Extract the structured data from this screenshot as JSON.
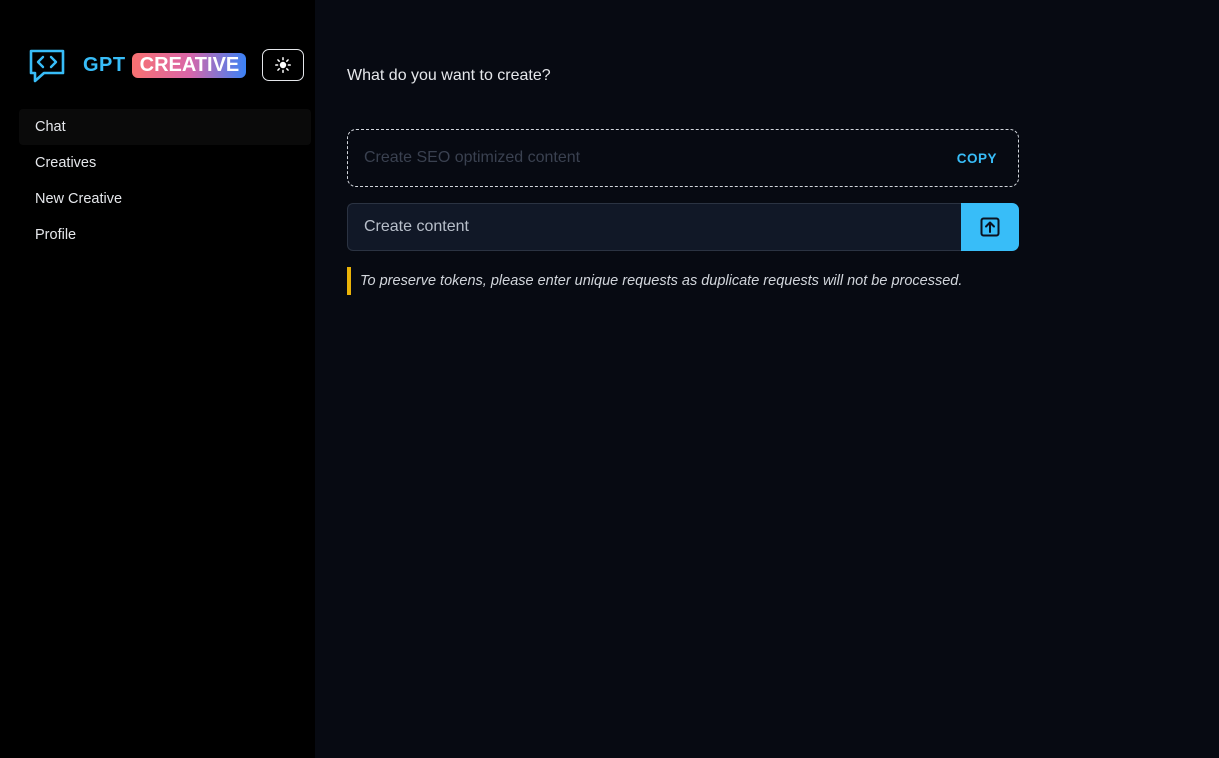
{
  "brand": {
    "gpt": "GPT",
    "creative": "CREATIVE"
  },
  "theme_toggle": {
    "icon": "sun-icon"
  },
  "nav": {
    "items": [
      {
        "label": "Chat",
        "active": true
      },
      {
        "label": "Creatives",
        "active": false
      },
      {
        "label": "New Creative",
        "active": false
      },
      {
        "label": "Profile",
        "active": false
      }
    ]
  },
  "main": {
    "question": "What do you want to create?",
    "output_placeholder": "Create SEO optimized content",
    "copy_label": "COPY",
    "input_placeholder": "Create content",
    "input_value": "",
    "notice": "To preserve tokens, please enter unique requests as duplicate requests will not be processed."
  },
  "colors": {
    "accent": "#38bdf8",
    "notice_bar": "#eab308",
    "sidebar_bg": "#000000",
    "main_bg": "#070a12"
  }
}
